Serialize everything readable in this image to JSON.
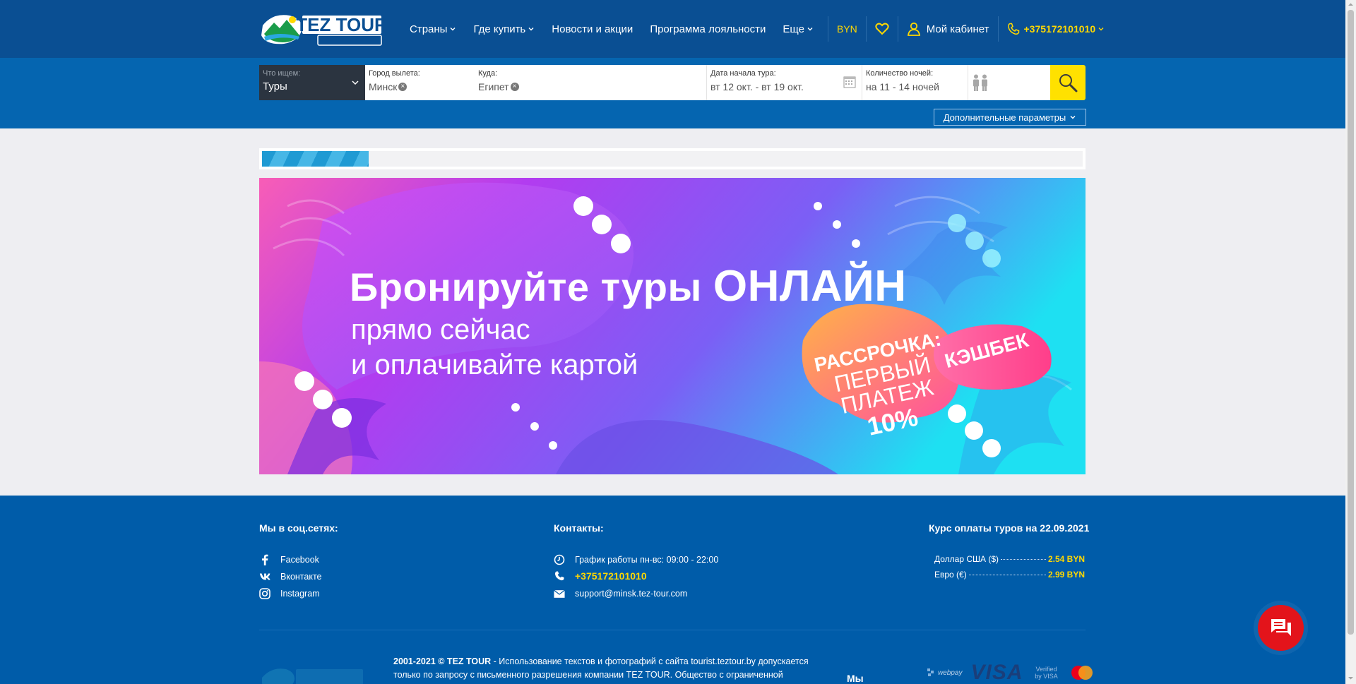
{
  "header": {
    "logo_text": "TEZ TOUR",
    "nav": [
      {
        "label": "Страны",
        "dropdown": true
      },
      {
        "label": "Где купить",
        "dropdown": true
      },
      {
        "label": "Новости и акции",
        "dropdown": false
      },
      {
        "label": "Программа лояльности",
        "dropdown": false
      },
      {
        "label": "Еще",
        "dropdown": true
      }
    ],
    "currency": "BYN",
    "cabinet_label": "Мой кабинет",
    "phone": "+375172101010",
    "colors": {
      "bar": "#0a4f93",
      "accent": "#ffd800"
    }
  },
  "search": {
    "what_label": "Что ищем:",
    "what_value": "Туры",
    "from_label": "Город вылета:",
    "from_value": "Минск",
    "to_label": "Куда:",
    "to_value": "Египет",
    "date_label": "Дата начала тура:",
    "date_value": "вт 12 окт. - вт 19 окт.",
    "nights_label": "Количество ночей:",
    "nights_value": "на 11 - 14 ночей",
    "more_params_label": "Дополнительные параметры"
  },
  "progress": {
    "fraction": 0.13
  },
  "banner": {
    "line1_a": "Бронируйте туры ",
    "line1_b": "ОНЛАЙН",
    "line2": "прямо сейчас",
    "line3": "и оплачивайте картой",
    "badge_installment_1": "РАССРОЧКА:",
    "badge_installment_2": "ПЕРВЫЙ",
    "badge_installment_3": "ПЛАТЕЖ",
    "badge_installment_4": "10%",
    "badge_cashback": "КЭШБЕК"
  },
  "footer": {
    "social_title": "Мы в соц.сетях:",
    "social": [
      "Facebook",
      "Вконтакте",
      "Instagram"
    ],
    "contacts_title": "Контакты:",
    "schedule": "График работы пн-вс: 09:00 - 22:00",
    "phone": "+375172101010",
    "email": "support@minsk.tez-tour.com",
    "rates_title": "Курс оплаты туров на 22.09.2021",
    "rates": [
      {
        "name": "Доллар США ($)",
        "value": "2.54 BYN"
      },
      {
        "name": "Евро (€)",
        "value": "2.99 BYN"
      }
    ],
    "copyright_bold": "2001-2021 © TEZ TOUR",
    "copyright_text": " - Использование текстов и фотографий с сайта tourist.teztour.by допускается только по запросу с письменного разрешения компании TEZ TOUR. Общество с ограниченной",
    "my_label": "Мы",
    "pay_webpay": "webpay",
    "pay_visa": "VISA",
    "pay_verified": "Verified by VISA"
  }
}
